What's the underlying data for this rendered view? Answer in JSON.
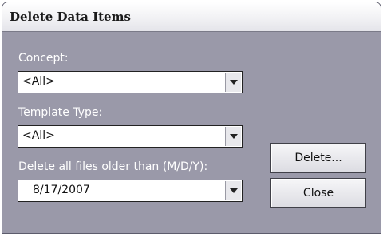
{
  "dialog": {
    "title": "Delete Data Items"
  },
  "concept": {
    "label": "Concept:",
    "value": "<All>"
  },
  "template_type": {
    "label": "Template Type:",
    "value": "<All>"
  },
  "older_than": {
    "label": "Delete all files older than (M/D/Y):",
    "value": "8/17/2007"
  },
  "buttons": {
    "delete": "Delete...",
    "close": "Close"
  },
  "icons": {
    "dropdown": "chevron-down-icon"
  },
  "colors": {
    "dialog_background": "#9a99a9",
    "label_text": "#ffffff",
    "titlebar": "#f0f0f3"
  }
}
